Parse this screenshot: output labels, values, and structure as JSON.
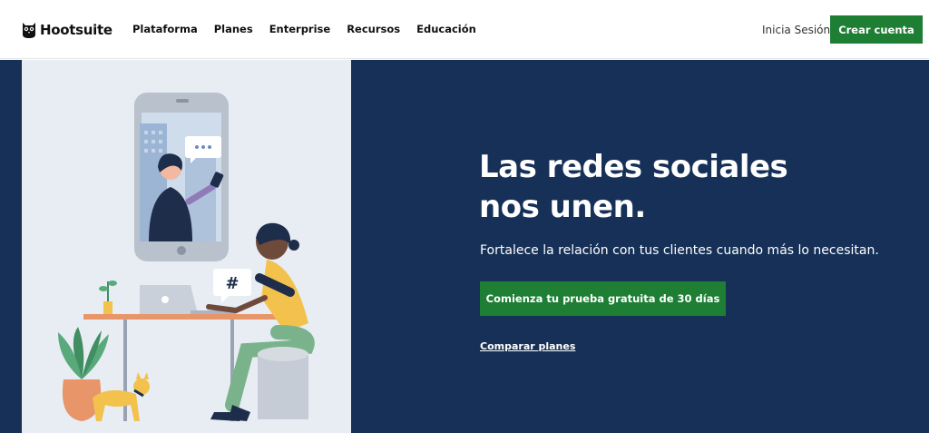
{
  "brand": {
    "name": "Hootsuite",
    "logo_icon": "owl-icon",
    "colors": {
      "accent": "#1e7e34",
      "hero_bg": "#163057",
      "illustration_bg": "#e8edf4"
    }
  },
  "nav": {
    "items": [
      {
        "label": "Plataforma"
      },
      {
        "label": "Planes"
      },
      {
        "label": "Enterprise"
      },
      {
        "label": "Recursos"
      },
      {
        "label": "Educación"
      }
    ],
    "login_label": "Inicia Sesión",
    "signup_label": "Crear cuenta"
  },
  "hero": {
    "headline_line1": "Las redes sociales",
    "headline_line2": "nos unen.",
    "subtitle": "Fortalece la relación con tus clientes cuando más lo necesitan.",
    "cta_label": "Comienza tu prueba gratuita de 30 días",
    "compare_label": "Comparar planes",
    "illustration_hashtag": "#"
  }
}
